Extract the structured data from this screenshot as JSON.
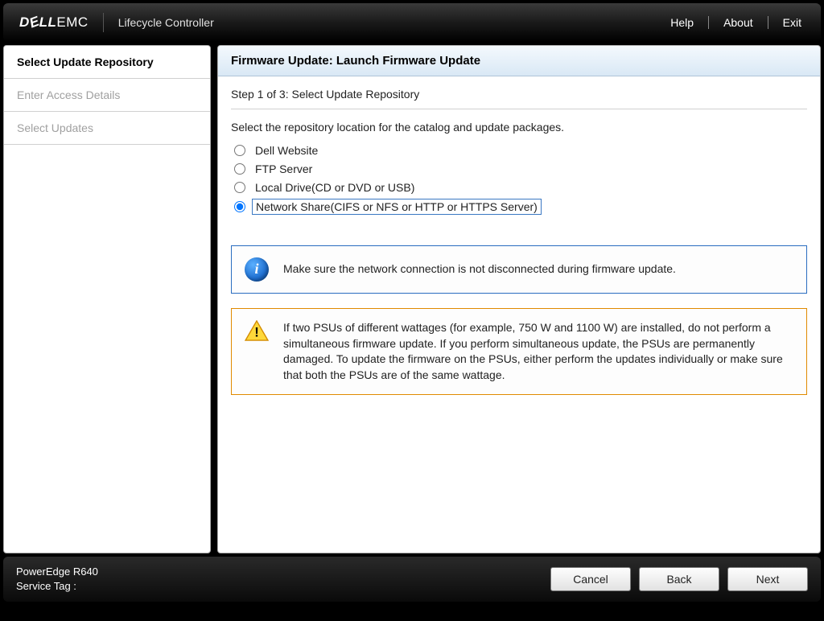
{
  "topbar": {
    "logo_dell": "D✓LL",
    "logo_emc": "EMC",
    "app_title": "Lifecycle Controller",
    "help": "Help",
    "about": "About",
    "exit": "Exit"
  },
  "sidebar": {
    "items": [
      {
        "label": "Select Update Repository",
        "active": true
      },
      {
        "label": "Enter Access Details",
        "active": false
      },
      {
        "label": "Select Updates",
        "active": false
      }
    ]
  },
  "main": {
    "title": "Firmware Update: Launch Firmware Update",
    "step_label": "Step 1 of 3: Select Update Repository",
    "instruction": "Select the repository location for the catalog and update packages.",
    "options": [
      {
        "label": "Dell Website",
        "selected": false
      },
      {
        "label": "FTP Server",
        "selected": false
      },
      {
        "label": "Local Drive(CD or DVD or USB)",
        "selected": false
      },
      {
        "label": "Network Share(CIFS or NFS or HTTP or HTTPS Server)",
        "selected": true
      }
    ],
    "info_msg": "Make sure the network connection is not disconnected during firmware update.",
    "warn_msg": "If two PSUs of different wattages (for example, 750 W and 1100 W) are installed, do not perform a simultaneous firmware update. If you perform simultaneous update, the PSUs are permanently damaged. To update the firmware on the PSUs, either perform the updates individually or make sure that both the PSUs are of the same wattage."
  },
  "bottombar": {
    "model": "PowerEdge R640",
    "service_tag_label": "Service Tag :",
    "service_tag_value": "",
    "cancel": "Cancel",
    "back": "Back",
    "next": "Next"
  }
}
